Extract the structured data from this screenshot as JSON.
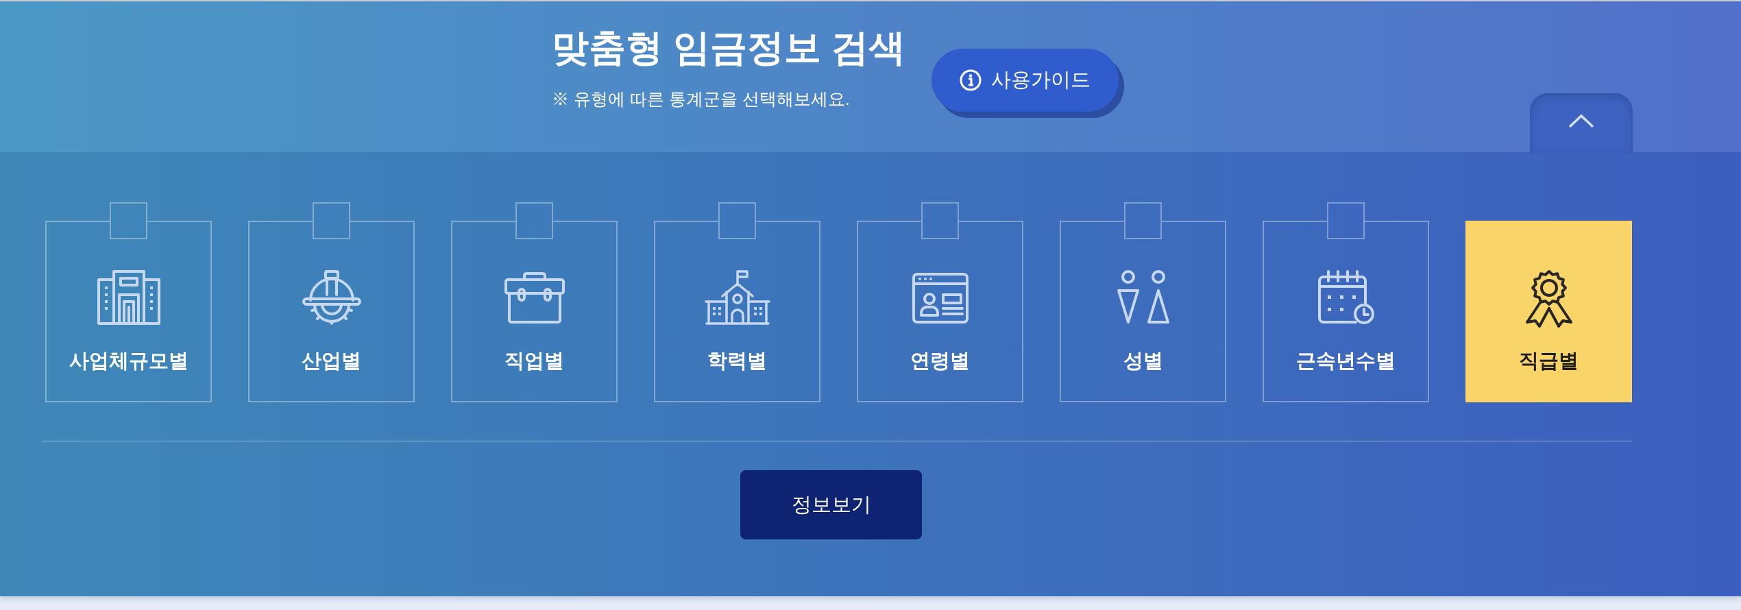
{
  "header": {
    "title": "맞춤형 임금정보 검색",
    "subtitle": "※ 유형에 따른 통계군을 선택해보세요.",
    "guide_button": {
      "label": "사용가이드"
    },
    "collapse_button": {
      "expanded": true
    }
  },
  "categories": [
    {
      "label": "사업체규모별",
      "selected": false
    },
    {
      "label": "산업별",
      "selected": false
    },
    {
      "label": "직업별",
      "selected": false
    },
    {
      "label": "학력별",
      "selected": false
    },
    {
      "label": "연령별",
      "selected": false
    },
    {
      "label": "성별",
      "selected": false
    },
    {
      "label": "근속년수별",
      "selected": false
    },
    {
      "label": "직급별",
      "selected": true
    }
  ],
  "submit_button": {
    "label": "정보보기"
  }
}
